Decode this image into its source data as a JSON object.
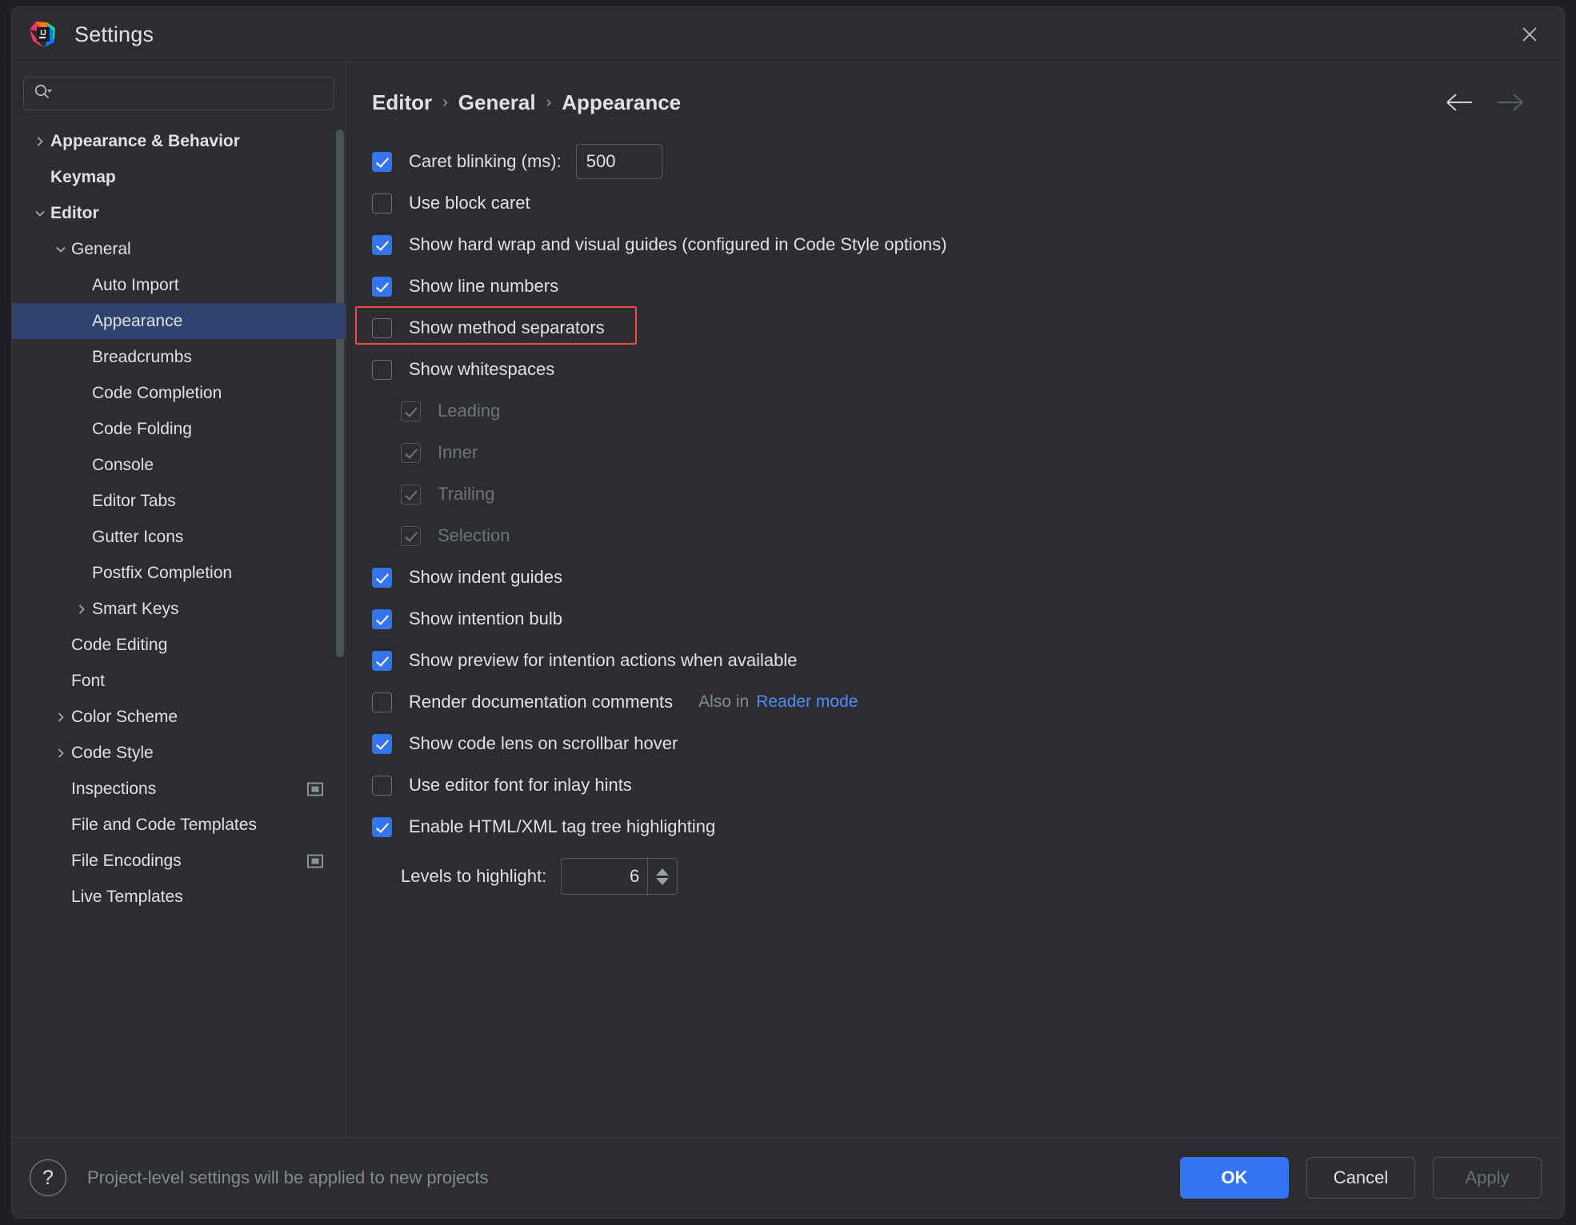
{
  "window": {
    "title": "Settings",
    "logo_icon": "intellij-idea-logo",
    "close_icon": "close-icon"
  },
  "search": {
    "value": "",
    "placeholder": "",
    "icon": "search-icon"
  },
  "sidebar": {
    "scrollbar": "vertical-scrollbar",
    "items": [
      {
        "label": "Appearance & Behavior",
        "indent": 0,
        "arrow": "chevron-right-icon",
        "bold": true,
        "selected": false,
        "badge": false
      },
      {
        "label": "Keymap",
        "indent": 0,
        "arrow": "none",
        "bold": true,
        "selected": false,
        "badge": false
      },
      {
        "label": "Editor",
        "indent": 0,
        "arrow": "chevron-down-icon",
        "bold": true,
        "selected": false,
        "badge": false
      },
      {
        "label": "General",
        "indent": 1,
        "arrow": "chevron-down-icon",
        "bold": false,
        "selected": false,
        "badge": false
      },
      {
        "label": "Auto Import",
        "indent": 2,
        "arrow": "none",
        "bold": false,
        "selected": false,
        "badge": false
      },
      {
        "label": "Appearance",
        "indent": 2,
        "arrow": "none",
        "bold": false,
        "selected": true,
        "badge": false
      },
      {
        "label": "Breadcrumbs",
        "indent": 2,
        "arrow": "none",
        "bold": false,
        "selected": false,
        "badge": false
      },
      {
        "label": "Code Completion",
        "indent": 2,
        "arrow": "none",
        "bold": false,
        "selected": false,
        "badge": false
      },
      {
        "label": "Code Folding",
        "indent": 2,
        "arrow": "none",
        "bold": false,
        "selected": false,
        "badge": false
      },
      {
        "label": "Console",
        "indent": 2,
        "arrow": "none",
        "bold": false,
        "selected": false,
        "badge": false
      },
      {
        "label": "Editor Tabs",
        "indent": 2,
        "arrow": "none",
        "bold": false,
        "selected": false,
        "badge": false
      },
      {
        "label": "Gutter Icons",
        "indent": 2,
        "arrow": "none",
        "bold": false,
        "selected": false,
        "badge": false
      },
      {
        "label": "Postfix Completion",
        "indent": 2,
        "arrow": "none",
        "bold": false,
        "selected": false,
        "badge": false
      },
      {
        "label": "Smart Keys",
        "indent": 2,
        "arrow": "chevron-right-icon",
        "bold": false,
        "selected": false,
        "badge": false
      },
      {
        "label": "Code Editing",
        "indent": 1,
        "arrow": "none",
        "bold": false,
        "selected": false,
        "badge": false
      },
      {
        "label": "Font",
        "indent": 1,
        "arrow": "none",
        "bold": false,
        "selected": false,
        "badge": false
      },
      {
        "label": "Color Scheme",
        "indent": 1,
        "arrow": "chevron-right-icon",
        "bold": false,
        "selected": false,
        "badge": false
      },
      {
        "label": "Code Style",
        "indent": 1,
        "arrow": "chevron-right-icon",
        "bold": false,
        "selected": false,
        "badge": false
      },
      {
        "label": "Inspections",
        "indent": 1,
        "arrow": "none",
        "bold": false,
        "selected": false,
        "badge": true
      },
      {
        "label": "File and Code Templates",
        "indent": 1,
        "arrow": "none",
        "bold": false,
        "selected": false,
        "badge": false
      },
      {
        "label": "File Encodings",
        "indent": 1,
        "arrow": "none",
        "bold": false,
        "selected": false,
        "badge": true
      },
      {
        "label": "Live Templates",
        "indent": 1,
        "arrow": "none",
        "bold": false,
        "selected": false,
        "badge": false
      }
    ]
  },
  "main": {
    "breadcrumb": [
      "Editor",
      "General",
      "Appearance"
    ],
    "breadcrumb_separator": "›",
    "nav": {
      "back_icon": "arrow-left-icon",
      "back_enabled": true,
      "forward_icon": "arrow-right-icon",
      "forward_enabled": false
    },
    "settings": [
      {
        "label": "Caret blinking (ms):",
        "checked": true,
        "enabled": true,
        "indent": 0,
        "control": "text",
        "value": "500",
        "highlighted": false
      },
      {
        "label": "Use block caret",
        "checked": false,
        "enabled": true,
        "indent": 0,
        "control": "none",
        "highlighted": false
      },
      {
        "label": "Show hard wrap and visual guides (configured in Code Style options)",
        "checked": true,
        "enabled": true,
        "indent": 0,
        "control": "none",
        "highlighted": false
      },
      {
        "label": "Show line numbers",
        "checked": true,
        "enabled": true,
        "indent": 0,
        "control": "none",
        "highlighted": false
      },
      {
        "label": "Show method separators",
        "checked": false,
        "enabled": true,
        "indent": 0,
        "control": "none",
        "highlighted": true
      },
      {
        "label": "Show whitespaces",
        "checked": false,
        "enabled": true,
        "indent": 0,
        "control": "none",
        "highlighted": false
      },
      {
        "label": "Leading",
        "checked": true,
        "enabled": false,
        "indent": 1,
        "control": "none",
        "highlighted": false
      },
      {
        "label": "Inner",
        "checked": true,
        "enabled": false,
        "indent": 1,
        "control": "none",
        "highlighted": false
      },
      {
        "label": "Trailing",
        "checked": true,
        "enabled": false,
        "indent": 1,
        "control": "none",
        "highlighted": false
      },
      {
        "label": "Selection",
        "checked": true,
        "enabled": false,
        "indent": 1,
        "control": "none",
        "highlighted": false
      },
      {
        "label": "Show indent guides",
        "checked": true,
        "enabled": true,
        "indent": 0,
        "control": "none",
        "highlighted": false
      },
      {
        "label": "Show intention bulb",
        "checked": true,
        "enabled": true,
        "indent": 0,
        "control": "none",
        "highlighted": false
      },
      {
        "label": "Show preview for intention actions when available",
        "checked": true,
        "enabled": true,
        "indent": 0,
        "control": "none",
        "highlighted": false
      },
      {
        "label": "Render documentation comments",
        "checked": false,
        "enabled": true,
        "indent": 0,
        "control": "link",
        "hint_text": "Also in",
        "link_text": "Reader mode",
        "highlighted": false
      },
      {
        "label": "Show code lens on scrollbar hover",
        "checked": true,
        "enabled": true,
        "indent": 0,
        "control": "none",
        "highlighted": false
      },
      {
        "label": "Use editor font for inlay hints",
        "checked": false,
        "enabled": true,
        "indent": 0,
        "control": "none",
        "highlighted": false
      },
      {
        "label": "Enable HTML/XML tag tree highlighting",
        "checked": true,
        "enabled": true,
        "indent": 0,
        "control": "none",
        "highlighted": false
      }
    ],
    "levels": {
      "label": "Levels to highlight:",
      "value": "6",
      "spinner_up_icon": "spinner-up-icon",
      "spinner_down_icon": "spinner-down-icon"
    }
  },
  "footer": {
    "help_icon": "help-icon",
    "help_glyph": "?",
    "note": "Project-level settings will be applied to new projects",
    "ok_label": "OK",
    "cancel_label": "Cancel",
    "apply_label": "Apply",
    "apply_enabled": false
  },
  "colors": {
    "accent": "#3574f0",
    "selection": "#2e436e",
    "highlight_box": "#f64a4a",
    "link": "#548af7",
    "dialog_bg": "#2b2d30",
    "text": "#dfe1e5",
    "muted_text": "#868a91",
    "disabled_text": "#6f737a"
  }
}
